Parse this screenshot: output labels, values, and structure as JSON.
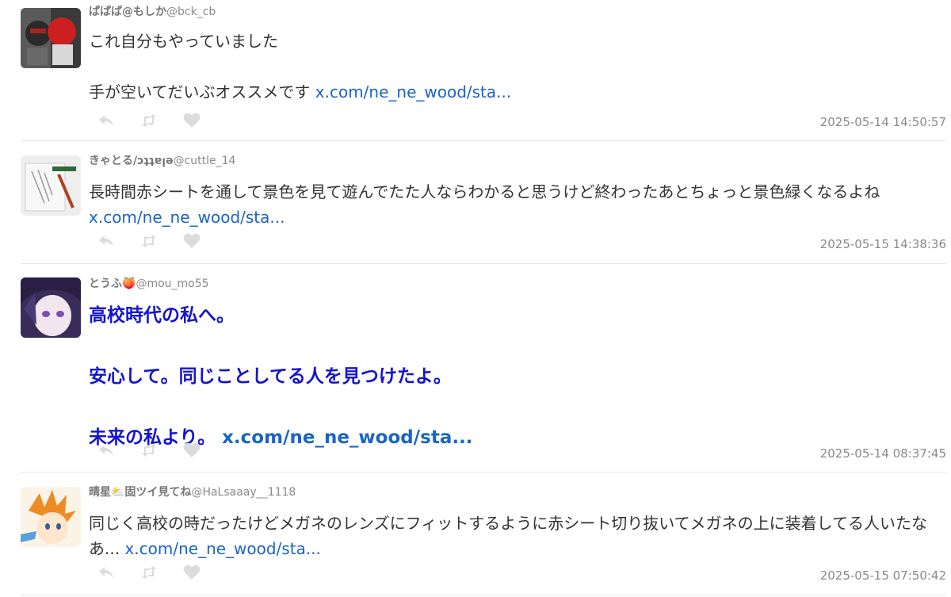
{
  "tweets": [
    {
      "display_name": "ぱぱぱ@もしか",
      "handle": "@bck_cb",
      "line1": "これ自分もやっていました",
      "line2": "手が空いてだいぶオススメです ",
      "link": "x.com/ne_ne_wood/sta...",
      "timestamp": "2025-05-14 14:50:57"
    },
    {
      "display_name": "きゃとる/ɔʇʇɐןǝ",
      "handle": "@cuttle_14",
      "text": "長時間赤シートを通して景色を見て遊んでたた人ならわかると思うけど終わったあとちょっと景色緑くなるよね ",
      "link": "x.com/ne_ne_wood/sta...",
      "timestamp": "2025-05-15 14:38:36"
    },
    {
      "display_name": "とうふ🍑",
      "handle": "@mou_mo55",
      "line1": "高校時代の私へ。",
      "line2": "安心して。同じことしてる人を見つけたよ。",
      "line3": "未来の私より。 ",
      "link": "x.com/ne_ne_wood/sta...",
      "timestamp": "2025-05-14 08:37:45"
    },
    {
      "display_name": "晴星⛅固ツイ見てね",
      "handle": "@HaLsaaay__1118",
      "text": "同じく高校の時だったけどメガネのレンズにフィットするように赤シート切り抜いてメガネの上に装着してる人いたなあ... ",
      "link": "x.com/ne_ne_wood/sta...",
      "timestamp": "2025-05-15 07:50:42"
    }
  ],
  "icons": {
    "reply": "reply-icon",
    "retweet": "retweet-icon",
    "like": "heart-icon"
  },
  "colors": {
    "link": "#1a64c8",
    "emphasis_text": "#1414d2",
    "meta_text": "#8a8a8a",
    "action_icon": "#dcdcdc"
  }
}
